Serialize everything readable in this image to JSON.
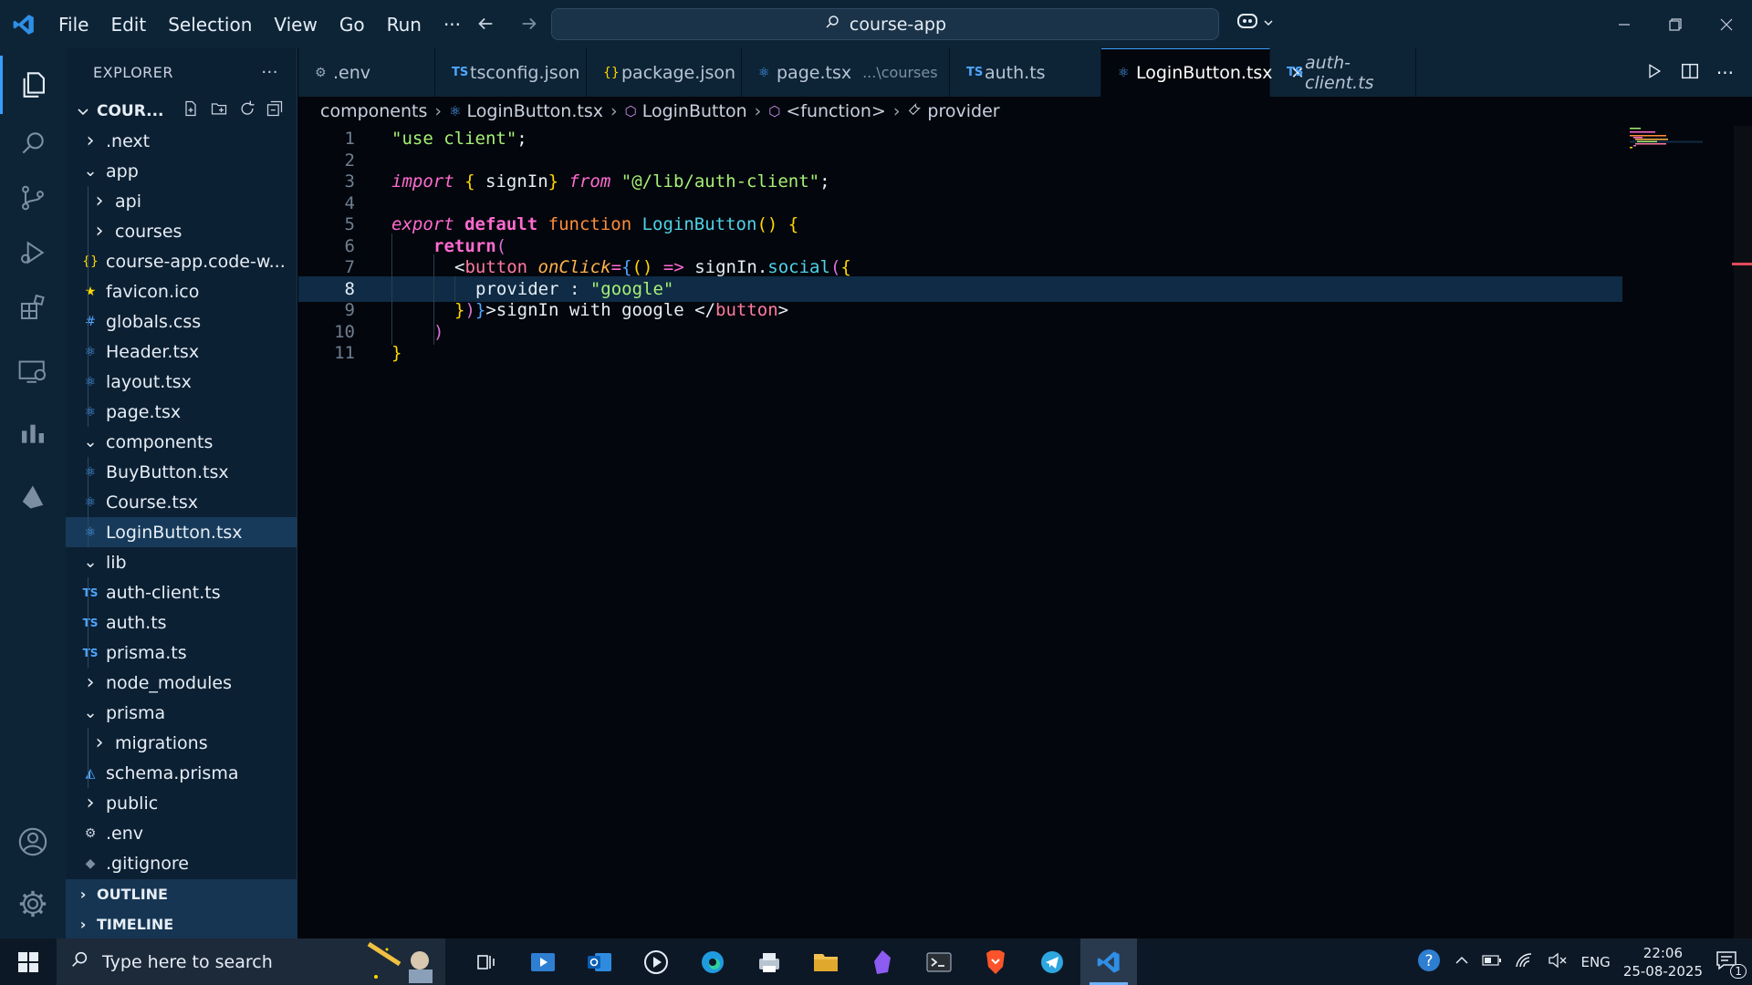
{
  "menu": [
    "File",
    "Edit",
    "Selection",
    "View",
    "Go",
    "Run",
    "···"
  ],
  "command_center": {
    "text": "course-app"
  },
  "sidebar": {
    "title": "EXPLORER",
    "more": "···",
    "folder": "COUR...",
    "tree": [
      {
        "label": ".next",
        "chev": "›",
        "icon": "",
        "depth": 0
      },
      {
        "label": "app",
        "chev": "⌄",
        "icon": "",
        "depth": 0
      },
      {
        "label": "api",
        "chev": "›",
        "icon": "",
        "depth": 1
      },
      {
        "label": "courses",
        "chev": "›",
        "icon": "",
        "depth": 1
      },
      {
        "label": "course-app.code-w...",
        "chev": "",
        "icon": "{}",
        "depth": 1
      },
      {
        "label": "favicon.ico",
        "chev": "",
        "icon": "★",
        "depth": 1
      },
      {
        "label": "globals.css",
        "chev": "",
        "icon": "#",
        "depth": 1
      },
      {
        "label": "Header.tsx",
        "chev": "",
        "icon": "⚛",
        "depth": 1
      },
      {
        "label": "layout.tsx",
        "chev": "",
        "icon": "⚛",
        "depth": 1
      },
      {
        "label": "page.tsx",
        "chev": "",
        "icon": "⚛",
        "depth": 1
      },
      {
        "label": "components",
        "chev": "⌄",
        "icon": "",
        "depth": 0
      },
      {
        "label": "BuyButton.tsx",
        "chev": "",
        "icon": "⚛",
        "depth": 1
      },
      {
        "label": "Course.tsx",
        "chev": "",
        "icon": "⚛",
        "depth": 1
      },
      {
        "label": "LoginButton.tsx",
        "chev": "",
        "icon": "⚛",
        "depth": 1,
        "selected": true
      },
      {
        "label": "lib",
        "chev": "⌄",
        "icon": "",
        "depth": 0
      },
      {
        "label": "auth-client.ts",
        "chev": "",
        "icon": "TS",
        "depth": 1
      },
      {
        "label": "auth.ts",
        "chev": "",
        "icon": "TS",
        "depth": 1
      },
      {
        "label": "prisma.ts",
        "chev": "",
        "icon": "TS",
        "depth": 1
      },
      {
        "label": "node_modules",
        "chev": "›",
        "icon": "",
        "depth": 0
      },
      {
        "label": "prisma",
        "chev": "⌄",
        "icon": "",
        "depth": 0
      },
      {
        "label": "migrations",
        "chev": "›",
        "icon": "",
        "depth": 1
      },
      {
        "label": "schema.prisma",
        "chev": "",
        "icon": "◭",
        "depth": 1
      },
      {
        "label": "public",
        "chev": "›",
        "icon": "",
        "depth": 0
      },
      {
        "label": ".env",
        "chev": "",
        "icon": "⚙",
        "depth": 0
      },
      {
        "label": ".gitignore",
        "chev": "",
        "icon": "◆",
        "depth": 0
      }
    ],
    "outline": "OUTLINE",
    "timeline": "TIMELINE"
  },
  "tabs": [
    {
      "label": ".env",
      "icon": "⚙",
      "icon_color": "#9aa7b6",
      "dim": ""
    },
    {
      "label": "tsconfig.json",
      "icon": "TS",
      "icon_color": "#4fa6ff",
      "dim": ""
    },
    {
      "label": "package.json",
      "icon": "{}",
      "icon_color": "#ffd700",
      "dim": ""
    },
    {
      "label": "page.tsx",
      "icon": "⚛",
      "icon_color": "#4fa6ff",
      "dim": "...\\courses"
    },
    {
      "label": "auth.ts",
      "icon": "TS",
      "icon_color": "#4fa6ff",
      "dim": ""
    },
    {
      "label": "LoginButton.tsx",
      "icon": "⚛",
      "icon_color": "#4fa6ff",
      "dim": "",
      "active": true
    },
    {
      "label": "auth-client.ts",
      "icon": "TS",
      "icon_color": "#4fa6ff",
      "dim": "",
      "italic": true
    }
  ],
  "breadcrumb": [
    "components",
    "LoginButton.tsx",
    "LoginButton",
    "<function>",
    "provider"
  ],
  "editor": {
    "line_numbers": [
      "1",
      "2",
      "3",
      "4",
      "5",
      "6",
      "7",
      "8",
      "9",
      "10",
      "11"
    ],
    "current_line": 8
  },
  "taskbar": {
    "search_placeholder": "Type here to search",
    "lang": "ENG",
    "time": "22:06",
    "date": "25-08-2025",
    "notifications": "1"
  },
  "colors": {
    "accent": "#3b9cff",
    "titlebar": "#0d2437",
    "editor_bg": "#03060c"
  }
}
